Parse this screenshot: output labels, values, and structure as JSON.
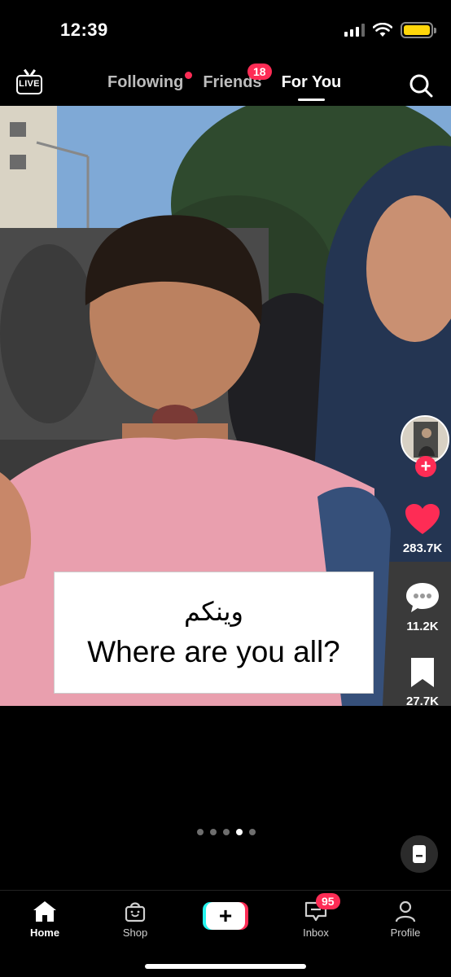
{
  "status_bar": {
    "time": "12:39"
  },
  "top_nav": {
    "live_label": "LIVE",
    "tabs": [
      {
        "label": "Following",
        "has_dot": true
      },
      {
        "label": "Friends",
        "badge": "18"
      },
      {
        "label": "For You",
        "active": true
      }
    ]
  },
  "video": {
    "caption_arabic": "وينكم",
    "caption_english": "Where are you all?"
  },
  "rail": {
    "follow_symbol": "+",
    "likes": "283.7K",
    "comments": "11.2K",
    "saves": "27.7K"
  },
  "pager": {
    "total": 5,
    "current": 4
  },
  "bottom_nav": {
    "items": [
      {
        "label": "Home",
        "icon": "home-icon",
        "active": true
      },
      {
        "label": "Shop",
        "icon": "shop-bag-icon"
      },
      {
        "label": "+",
        "icon": "create-plus-icon"
      },
      {
        "label": "Inbox",
        "icon": "inbox-icon",
        "badge": "95"
      },
      {
        "label": "Profile",
        "icon": "person-icon"
      }
    ]
  },
  "colors": {
    "accent": "#fe2c55",
    "cyan": "#25f4ee",
    "background": "#000000"
  }
}
